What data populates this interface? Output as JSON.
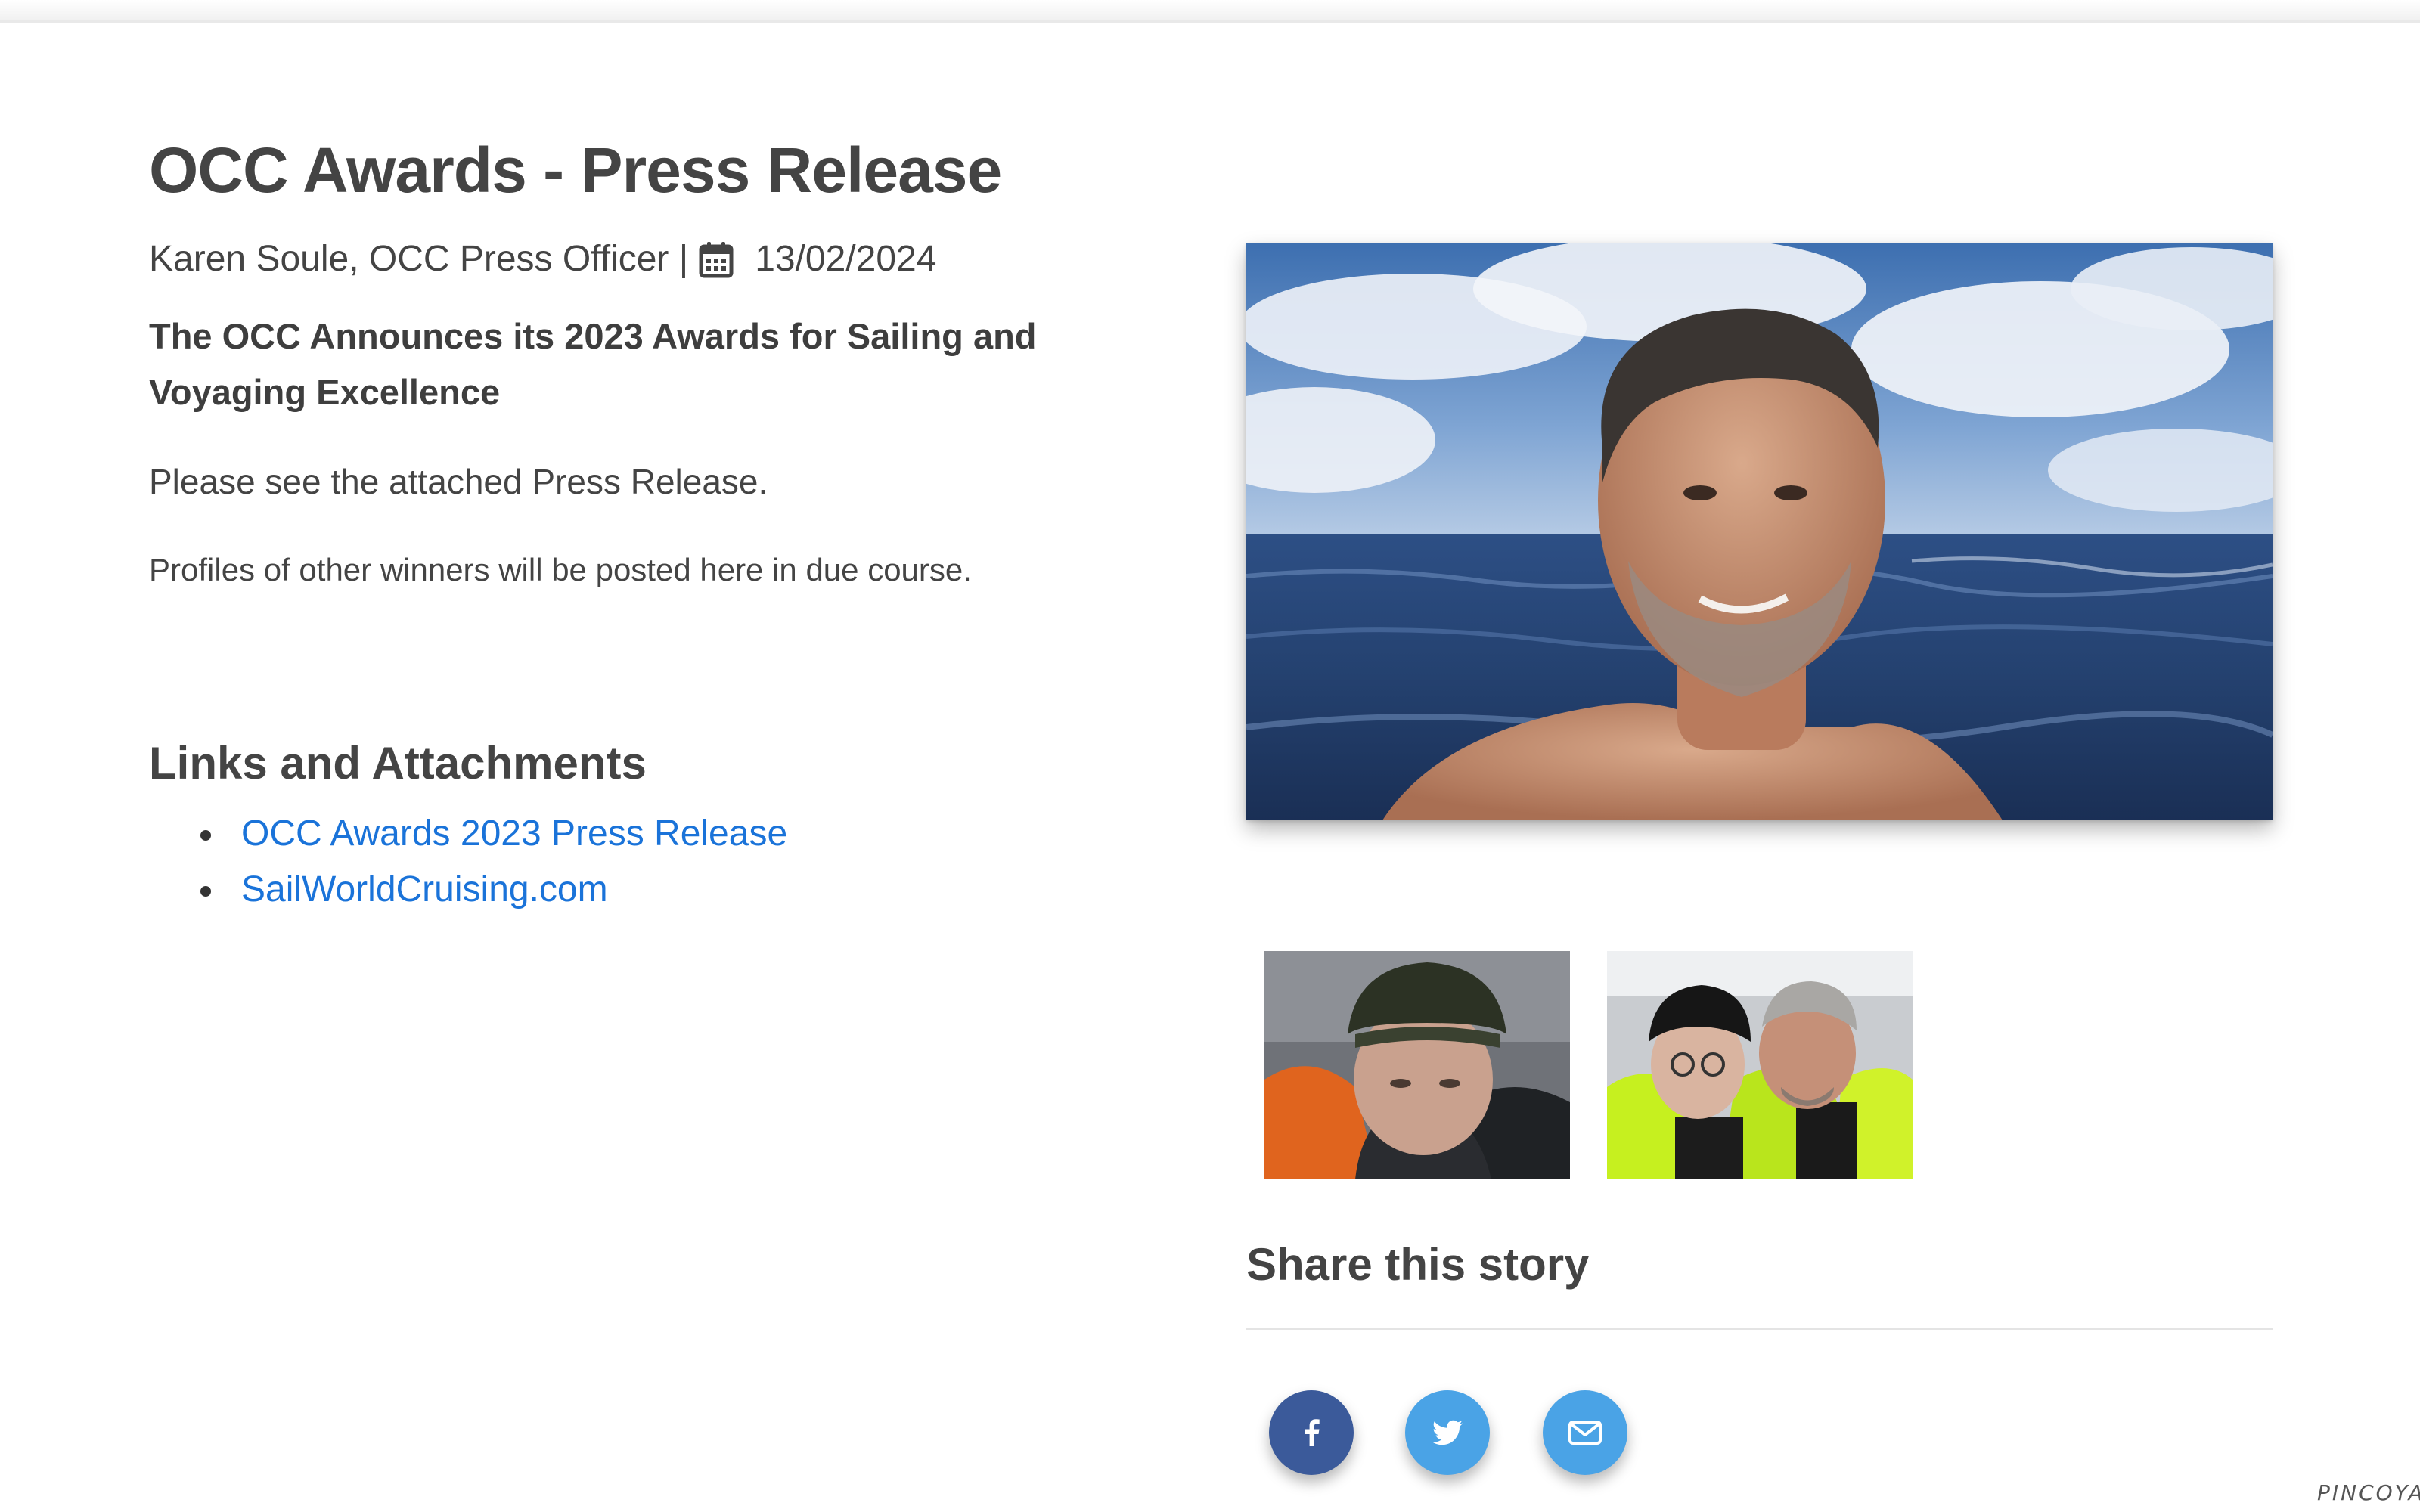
{
  "article": {
    "title": "OCC Awards - Press Release",
    "author": "Karen Soule, OCC Press Officer |",
    "date": "13/02/2024",
    "lead": "The OCC Announces its 2023 Awards for Sailing and Voyaging Excellence",
    "paragraph_1": "Please see the attached Press Release.",
    "paragraph_2": "Profiles of other winners will be posted here in due course."
  },
  "links": {
    "title": "Links and Attachments",
    "items": [
      {
        "label": "OCC Awards 2023 Press Release"
      },
      {
        "label": "SailWorldCruising.com"
      }
    ]
  },
  "share": {
    "title": "Share this story",
    "buttons": [
      {
        "icon": "facebook-icon",
        "color": "#3b5a9a"
      },
      {
        "icon": "twitter-icon",
        "color": "#4aa3e6"
      },
      {
        "icon": "email-icon",
        "color": "#4aa3e6"
      }
    ]
  },
  "theme": {
    "text": "#444444",
    "link": "#1a73d9"
  },
  "watermark": "PINCOYA"
}
